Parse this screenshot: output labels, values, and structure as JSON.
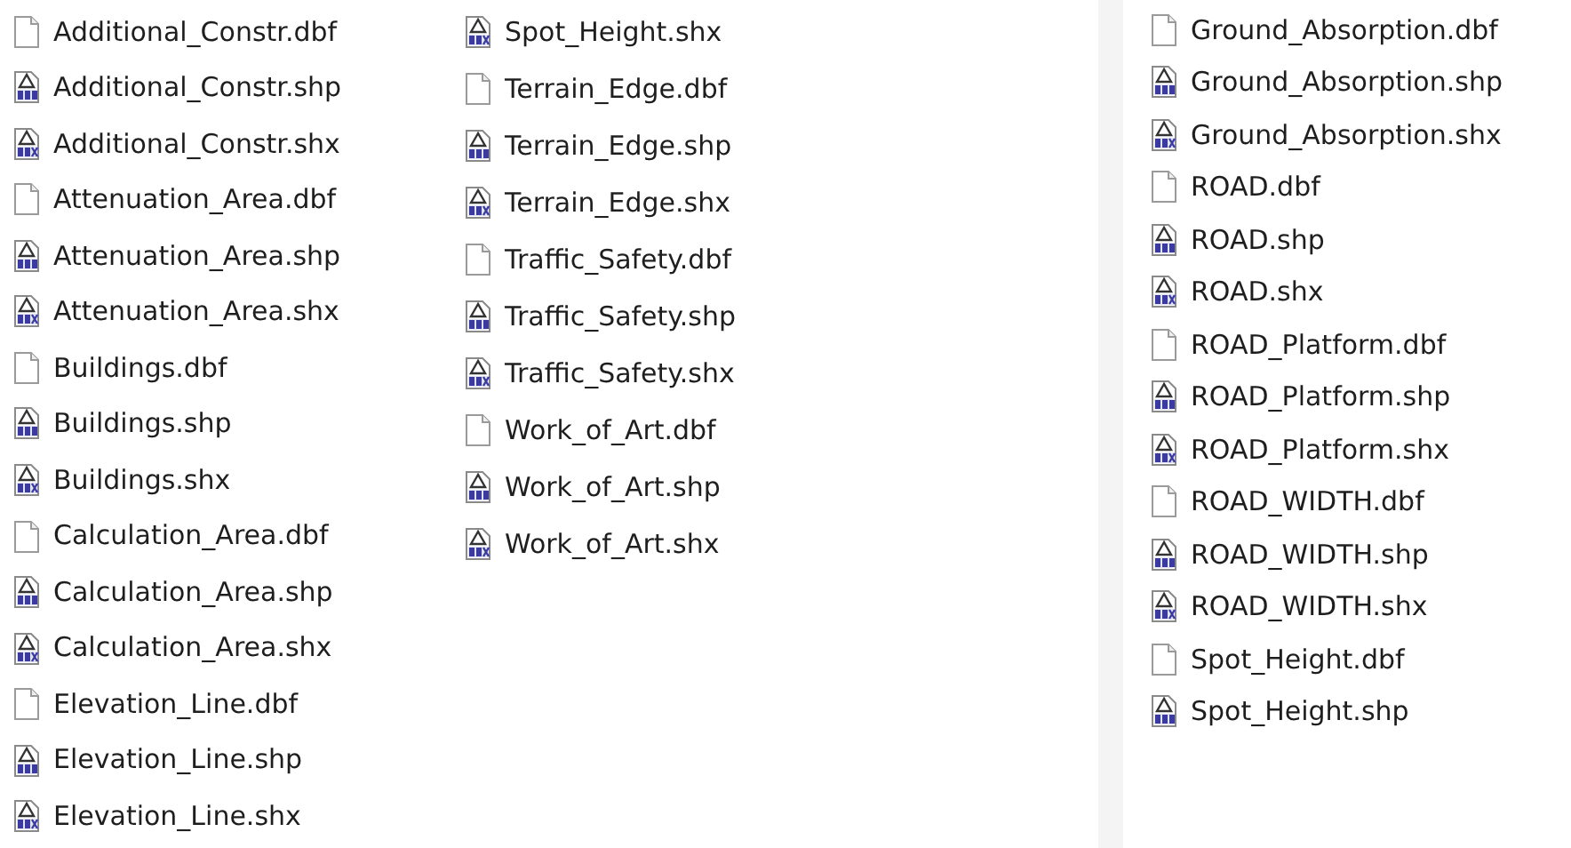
{
  "panels": [
    {
      "columns": [
        {
          "files": [
            {
              "name": "Additional_Constr.dbf",
              "kind": "blank"
            },
            {
              "name": "Additional_Constr.shp",
              "kind": "shp"
            },
            {
              "name": "Additional_Constr.shx",
              "kind": "shx"
            },
            {
              "name": "Attenuation_Area.dbf",
              "kind": "blank"
            },
            {
              "name": "Attenuation_Area.shp",
              "kind": "shp"
            },
            {
              "name": "Attenuation_Area.shx",
              "kind": "shx"
            },
            {
              "name": "Buildings.dbf",
              "kind": "blank"
            },
            {
              "name": "Buildings.shp",
              "kind": "shp"
            },
            {
              "name": "Buildings.shx",
              "kind": "shx"
            },
            {
              "name": "Calculation_Area.dbf",
              "kind": "blank"
            },
            {
              "name": "Calculation_Area.shp",
              "kind": "shp"
            },
            {
              "name": "Calculation_Area.shx",
              "kind": "shx"
            },
            {
              "name": "Elevation_Line.dbf",
              "kind": "blank"
            },
            {
              "name": "Elevation_Line.shp",
              "kind": "shp"
            },
            {
              "name": "Elevation_Line.shx",
              "kind": "shx"
            }
          ]
        },
        {
          "files": [
            {
              "name": "Spot_Height.shx",
              "kind": "shx"
            },
            {
              "name": "Terrain_Edge.dbf",
              "kind": "blank"
            },
            {
              "name": "Terrain_Edge.shp",
              "kind": "shp"
            },
            {
              "name": "Terrain_Edge.shx",
              "kind": "shx"
            },
            {
              "name": "Traffic_Safety.dbf",
              "kind": "blank"
            },
            {
              "name": "Traffic_Safety.shp",
              "kind": "shp"
            },
            {
              "name": "Traffic_Safety.shx",
              "kind": "shx"
            },
            {
              "name": "Work_of_Art.dbf",
              "kind": "blank"
            },
            {
              "name": "Work_of_Art.shp",
              "kind": "shp"
            },
            {
              "name": "Work_of_Art.shx",
              "kind": "shx"
            }
          ]
        }
      ]
    },
    {
      "columns": [
        {
          "files": [
            {
              "name": "Ground_Absorption.dbf",
              "kind": "blank"
            },
            {
              "name": "Ground_Absorption.shp",
              "kind": "shp"
            },
            {
              "name": "Ground_Absorption.shx",
              "kind": "shx"
            },
            {
              "name": "ROAD.dbf",
              "kind": "blank"
            },
            {
              "name": "ROAD.shp",
              "kind": "shp"
            },
            {
              "name": "ROAD.shx",
              "kind": "shx"
            },
            {
              "name": "ROAD_Platform.dbf",
              "kind": "blank"
            },
            {
              "name": "ROAD_Platform.shp",
              "kind": "shp"
            },
            {
              "name": "ROAD_Platform.shx",
              "kind": "shx"
            },
            {
              "name": "ROAD_WIDTH.dbf",
              "kind": "blank"
            },
            {
              "name": "ROAD_WIDTH.shp",
              "kind": "shp"
            },
            {
              "name": "ROAD_WIDTH.shx",
              "kind": "shx"
            },
            {
              "name": "Spot_Height.dbf",
              "kind": "blank"
            },
            {
              "name": "Spot_Height.shp",
              "kind": "shp"
            }
          ]
        }
      ]
    }
  ]
}
